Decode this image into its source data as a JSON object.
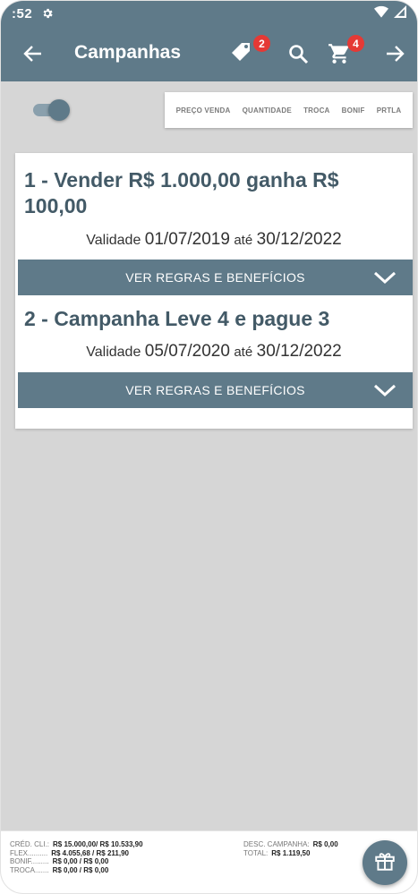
{
  "status_bar": {
    "time": ":52",
    "icons": [
      "gear-icon",
      "wifi-icon",
      "signal-icon"
    ]
  },
  "app_bar": {
    "title": "Campanhas",
    "tag_badge": "2",
    "cart_badge": "4",
    "icons": [
      "back-arrow-icon",
      "tag-icon",
      "search-icon",
      "cart-icon",
      "forward-arrow-icon"
    ]
  },
  "toggle": {
    "on": true
  },
  "filters": [
    "PREÇO VENDA",
    "QUANTIDADE",
    "TROCA",
    "BONIF",
    "PRTLA"
  ],
  "campaigns": [
    {
      "title": "1 - Vender R$ 1.000,00 ganha R$ 100,00",
      "validity_label": "Validade",
      "start": "01/07/2019",
      "until": "até",
      "end": "30/12/2022",
      "button": "VER REGRAS E BENEFÍCIOS"
    },
    {
      "title": "2 - Campanha Leve 4 e pague 3",
      "validity_label": "Validade",
      "start": "05/07/2020",
      "until": "até",
      "end": "30/12/2022",
      "button": "VER REGRAS E BENEFÍCIOS"
    }
  ],
  "footer": {
    "left": [
      {
        "label": "CRÉD. CLI.:",
        "value": "R$ 15.000,00/ R$ 10.533,90"
      },
      {
        "label": "FLEX..........",
        "value": "R$ 4.055,68 / R$ 211,90"
      },
      {
        "label": "BONIF.........",
        "value": "R$ 0,00 / R$ 0,00"
      },
      {
        "label": "TROCA.......",
        "value": "R$ 0,00 / R$ 0,00"
      }
    ],
    "right": [
      {
        "label": "DESC. CAMPANHA:",
        "value": "R$ 0,00"
      },
      {
        "label": "TOTAL:",
        "value": "R$ 1.119,50"
      }
    ]
  },
  "colors": {
    "primary": "#5f7a89",
    "background": "#d6d6d6",
    "badge": "#e53935",
    "title_text": "#435a67"
  }
}
